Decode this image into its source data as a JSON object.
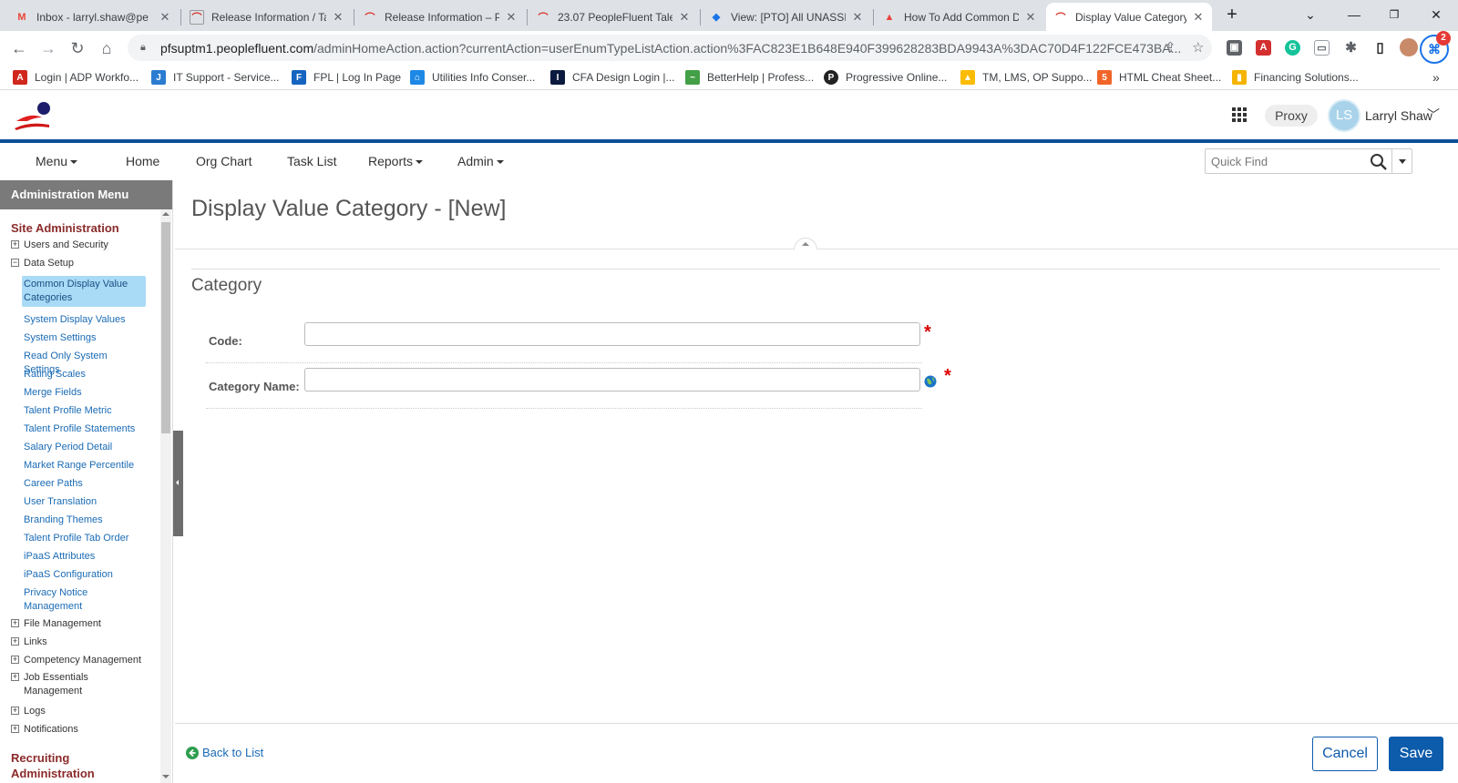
{
  "browser": {
    "tabs": [
      {
        "title": "Inbox - larryl.shaw@pe",
        "icon": "gmail-icon",
        "color": "#ea4335"
      },
      {
        "title": "Release Information / Ta",
        "icon": "peoplefluent-icon",
        "color": "#d93025"
      },
      {
        "title": "Release Information – P",
        "icon": "peoplefluent-icon",
        "color": "#d93025"
      },
      {
        "title": "23.07 PeopleFluent Tale",
        "icon": "peoplefluent-icon",
        "color": "#d93025"
      },
      {
        "title": "View: [PTO] All UNASSIG",
        "icon": "view-icon",
        "color": "#1a73e8"
      },
      {
        "title": "How To Add Common D",
        "icon": "howto-icon",
        "color": "#e8453c"
      },
      {
        "title": "Display Value Category",
        "icon": "peoplefluent-icon",
        "color": "#d93025"
      }
    ],
    "url_host": "pfsuptm1.peoplefluent.com",
    "url_path": "/adminHomeAction.action?currentAction=userEnumTypeListAction.action%3FAC823E1B648E940F399628283BDA9943A%3DAC70D4F122FCE473BA...",
    "extension_badge": "2",
    "bookmarks": [
      {
        "label": "Login | ADP Workfo...",
        "color": "#d0271d",
        "glyph": "A"
      },
      {
        "label": "IT Support - Service...",
        "color": "#2b7bd1",
        "glyph": "J"
      },
      {
        "label": "FPL | Log In Page",
        "color": "#1565c0",
        "glyph": "F"
      },
      {
        "label": "Utilities Info Conser...",
        "color": "#1e88e5",
        "glyph": "⌂"
      },
      {
        "label": "CFA Design Login |...",
        "color": "#0b1a3e",
        "glyph": "I"
      },
      {
        "label": "BetterHelp | Profess...",
        "color": "#43a047",
        "glyph": "~"
      },
      {
        "label": "Progressive Online...",
        "color": "#222222",
        "glyph": "P"
      },
      {
        "label": "TM, LMS, OP Suppo...",
        "color": "#fbbc04",
        "glyph": "▲"
      },
      {
        "label": "HTML Cheat Sheet...",
        "color": "#f16529",
        "glyph": "5"
      },
      {
        "label": "Financing Solutions...",
        "color": "#f4b400",
        "glyph": "▮"
      }
    ]
  },
  "header": {
    "proxy_label": "Proxy",
    "avatar_initials": "LS",
    "user_name": "Larryl Shaw"
  },
  "nav": {
    "items": [
      "Menu",
      "Home",
      "Org Chart",
      "Task List",
      "Reports",
      "Admin"
    ],
    "quickfind_placeholder": "Quick Find"
  },
  "sidebar": {
    "heading": "Administration Menu",
    "section1": "Site Administration",
    "users_security": "Users and Security",
    "data_setup": "Data Setup",
    "links": [
      "Common Display Value Categories",
      "System Display Values",
      "System Settings",
      "Read Only System Settings",
      "Rating Scales",
      "Merge Fields",
      "Talent Profile Metric",
      "Talent Profile Statements",
      "Salary Period Detail",
      "Market Range Percentile",
      "Career Paths",
      "User Translation",
      "Branding Themes",
      "Talent Profile Tab Order",
      "iPaaS Attributes",
      "iPaaS Configuration",
      "Privacy Notice Management"
    ],
    "nodes": [
      "File Management",
      "Links",
      "Competency Management",
      "Job Essentials Management",
      "Logs",
      "Notifications"
    ],
    "section2": "Recruiting Administration"
  },
  "content": {
    "page_title": "Display Value Category - [New]",
    "section_title": "Category",
    "code_label": "Code:",
    "code_value": "",
    "category_name_label": "Category Name:",
    "category_name_value": "",
    "required_mark": "*"
  },
  "footer": {
    "back_label": "Back to List",
    "cancel_label": "Cancel",
    "save_label": "Save"
  },
  "colors": {
    "brand_blue": "#0d4f96",
    "button_blue": "#0d5bab",
    "section_red": "#8b2a2a",
    "link_blue": "#1a6bb5",
    "selected_bg": "#a9dbf6"
  }
}
